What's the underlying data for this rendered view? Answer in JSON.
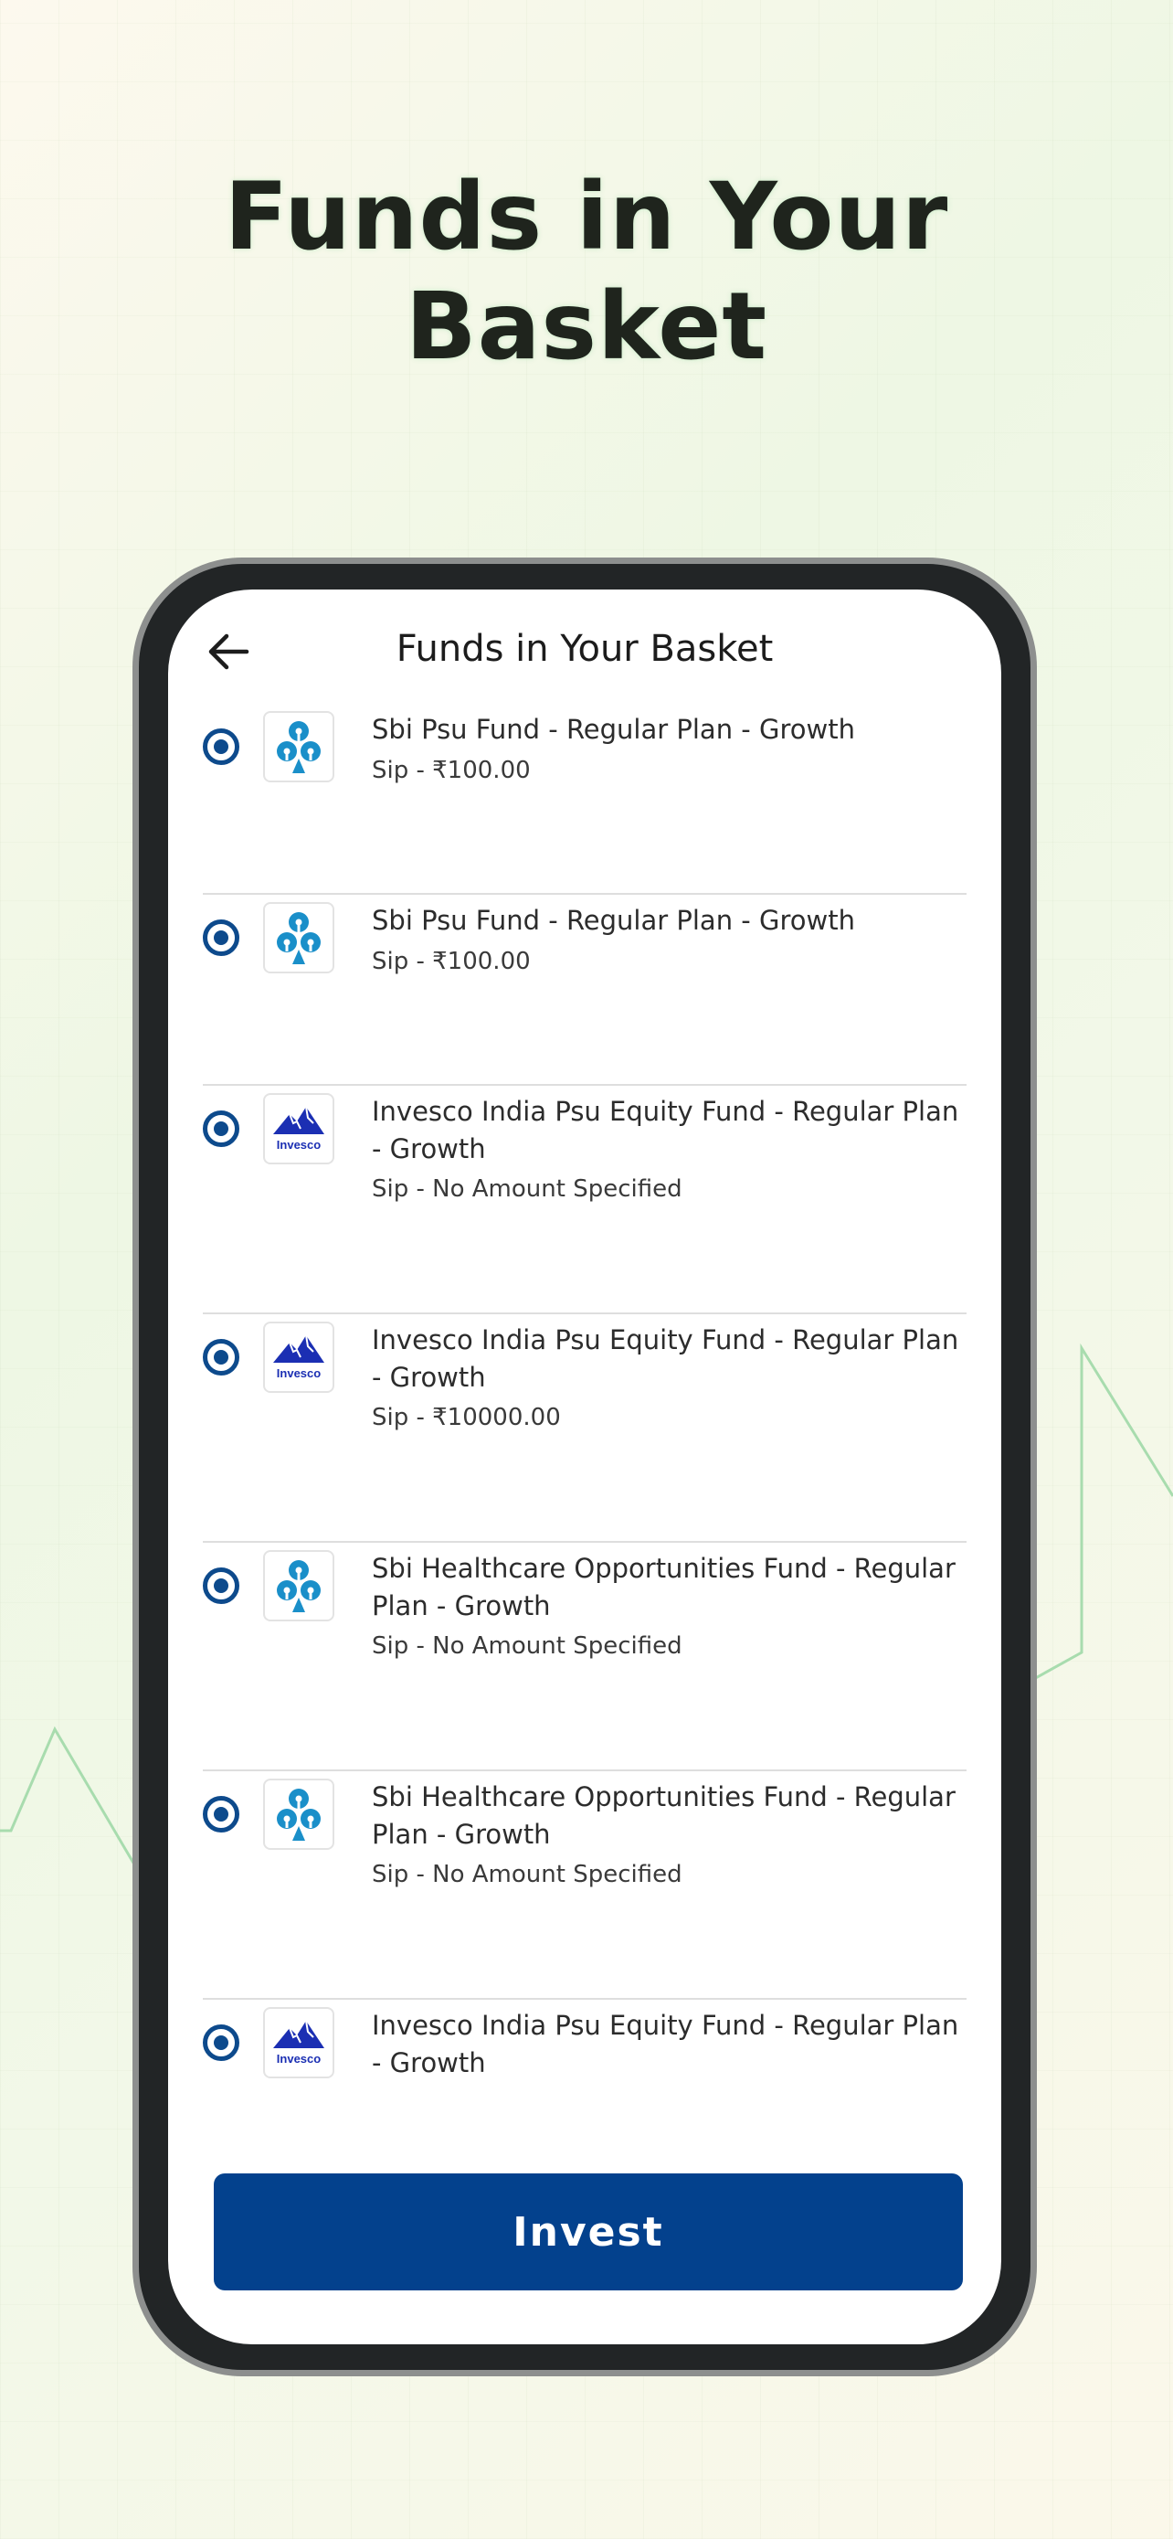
{
  "headline": {
    "line1": "Funds in Your",
    "line2": "Basket"
  },
  "app_bar": {
    "title": "Funds in Your Basket",
    "back_icon": "arrow-left-icon"
  },
  "funds": [
    {
      "name": "Sbi Psu Fund - Regular Plan - Growth",
      "sip": "Sip - ₹100.00",
      "logo": "sbi",
      "selected": true
    },
    {
      "name": "Sbi Psu Fund - Regular Plan - Growth",
      "sip": "Sip - ₹100.00",
      "logo": "sbi",
      "selected": true
    },
    {
      "name": "Invesco India Psu Equity Fund - Regular Plan - Growth",
      "sip": "Sip - No Amount Specified",
      "logo": "invesco",
      "selected": true
    },
    {
      "name": "Invesco India Psu Equity Fund - Regular Plan - Growth",
      "sip": "Sip - ₹10000.00",
      "logo": "invesco",
      "selected": true
    },
    {
      "name": "Sbi Healthcare Opportunities Fund - Regular Plan - Growth",
      "sip": "Sip - No Amount Specified",
      "logo": "sbi",
      "selected": true
    },
    {
      "name": "Sbi Healthcare Opportunities Fund - Regular Plan - Growth",
      "sip": "Sip - No Amount Specified",
      "logo": "sbi",
      "selected": true
    },
    {
      "name": "Invesco India Psu Equity Fund - Regular Plan - Growth",
      "sip": "",
      "logo": "invesco",
      "selected": true
    }
  ],
  "invest_button": {
    "label": "Invest"
  },
  "logo_text": {
    "invesco": "Invesco"
  },
  "colors": {
    "primary": "#03418d",
    "radio": "#0d4a8c",
    "sbi_blue": "#1a8fc9",
    "invesco_blue": "#1b2fb3",
    "trend_green": "#a8dcae"
  }
}
